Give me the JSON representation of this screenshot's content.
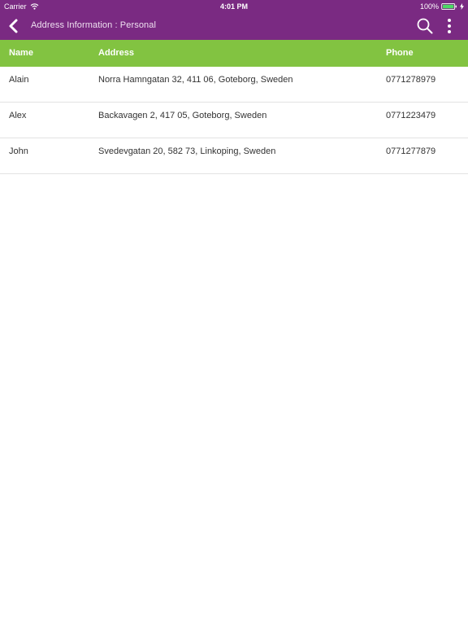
{
  "status_bar": {
    "carrier": "Carrier",
    "time": "4:01 PM",
    "battery": "100%"
  },
  "nav": {
    "title": "Address Information : Personal",
    "back_icon": "chevron-left-icon",
    "search_icon": "search-icon",
    "more_icon": "more-vertical-icon"
  },
  "table": {
    "headers": {
      "name": "Name",
      "address": "Address",
      "phone": "Phone"
    },
    "rows": [
      {
        "name": "Alain",
        "address": "Norra Hamngatan 32, 411 06, Goteborg, Sweden",
        "phone": "0771278979"
      },
      {
        "name": "Alex",
        "address": "Backavagen 2, 417 05, Goteborg, Sweden",
        "phone": "0771223479"
      },
      {
        "name": "John",
        "address": "Svedevgatan 20, 582 73, Linkoping, Sweden",
        "phone": "0771277879"
      }
    ]
  },
  "colors": {
    "header_purple": "#7a2a82",
    "table_header_green": "#82c341",
    "battery_green": "#4cd964"
  }
}
